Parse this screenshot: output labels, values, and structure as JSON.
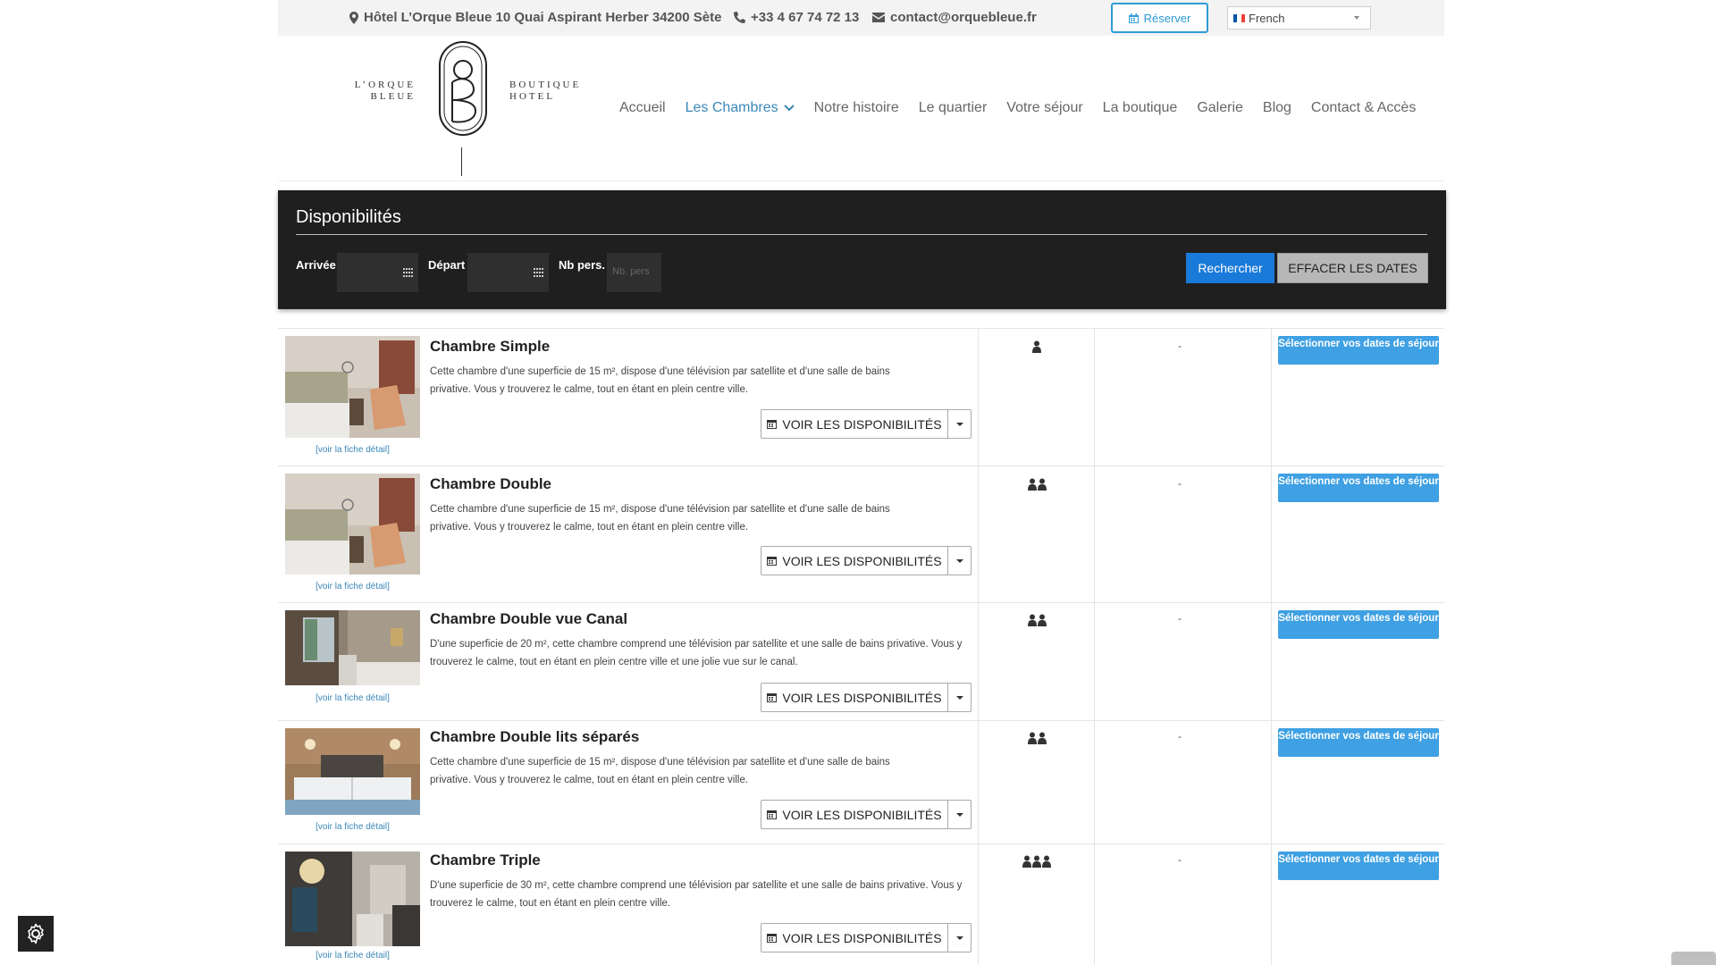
{
  "topbar": {
    "address": "Hôtel L’Orque Bleue 10 Quai Aspirant Herber 34200 Sète",
    "phone": "+33 4 67 74 72 13",
    "email": "contact@orquebleue.fr",
    "reserve_label": "Réserver",
    "language": "French",
    "accent_color": "#2e9bd6"
  },
  "logo": {
    "left_line1": "L’ORQUE",
    "left_line2": "BLEUE",
    "right_line1": "BOUTIQUE",
    "right_line2": "HOTEL"
  },
  "nav": {
    "items": [
      "Accueil",
      "Les Chambres",
      "Notre histoire",
      "Le quartier",
      "Votre séjour",
      "La boutique",
      "Galerie",
      "Blog",
      "Contact & Accès"
    ],
    "active_index": 1,
    "active_color": "#3b87b8"
  },
  "availability": {
    "title": "Disponibilités",
    "arrival_label": "Arrivée",
    "departure_label": "Départ",
    "persons_label": "Nb pers.",
    "persons_placeholder": "Nb. pers",
    "search_label": "Rechercher",
    "clear_label": "EFFACER LES DATES"
  },
  "rooms": [
    {
      "name": "Chambre Simple",
      "description": "Cette chambre d'une superficie de 15 m², dispose d'une télévision par satellite et d'une salle de bains privative. Vous y trouverez le calme, tout en étant en plein centre ville.",
      "capacity": 1,
      "price": "-",
      "detail_link": "[voir la fiche détail]",
      "dispo_label": "VOIR LES DISPONIBILITÉS",
      "select_label": "Sélectionner vos dates de séjour"
    },
    {
      "name": "Chambre Double",
      "description": "Cette chambre d'une superficie de 15 m², dispose d'une télévision par satellite et d'une salle de bains privative. Vous y trouverez le calme, tout en étant en plein centre ville.",
      "capacity": 2,
      "price": "-",
      "detail_link": "[voir la fiche détail]",
      "dispo_label": "VOIR LES DISPONIBILITÉS",
      "select_label": "Sélectionner vos dates de séjour"
    },
    {
      "name": "Chambre Double vue Canal",
      "description": "D'une superficie de 20 m², cette chambre comprend une télévision par satellite et une salle de bains privative. Vous y trouverez le calme, tout en étant en plein centre ville et une jolie vue sur le canal.",
      "capacity": 2,
      "price": "-",
      "detail_link": "[voir la fiche détail]",
      "dispo_label": "VOIR LES DISPONIBILITÉS",
      "select_label": "Sélectionner vos dates de séjour"
    },
    {
      "name": "Chambre Double lits séparés",
      "description": "Cette chambre d'une superficie de 15 m², dispose d'une télévision par satellite et d'une salle de bains privative. Vous y trouverez le calme, tout en étant en plein centre ville.",
      "capacity": 2,
      "price": "-",
      "detail_link": "[voir la fiche détail]",
      "dispo_label": "VOIR LES DISPONIBILITÉS",
      "select_label": "Sélectionner vos dates de séjour"
    },
    {
      "name": "Chambre Triple",
      "description": "D'une superficie de 30 m², cette chambre comprend une télévision par satellite et une salle de bains privative. Vous y trouverez le calme, tout en étant en plein centre ville.",
      "capacity": 3,
      "price": "-",
      "detail_link": "[voir la fiche détail]",
      "dispo_label": "VOIR LES DISPONIBILITÉS",
      "select_label": "Sélectionner vos dates de séjour"
    }
  ]
}
